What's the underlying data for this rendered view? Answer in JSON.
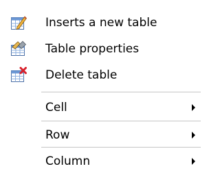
{
  "context_menu": {
    "items": [
      {
        "label": "Inserts a new table",
        "icon": "insert-table-icon"
      },
      {
        "label": "Table properties",
        "icon": "table-properties-icon"
      },
      {
        "label": "Delete table",
        "icon": "delete-table-icon"
      }
    ],
    "submenus": [
      {
        "label": "Cell"
      },
      {
        "label": "Row"
      },
      {
        "label": "Column"
      }
    ]
  }
}
